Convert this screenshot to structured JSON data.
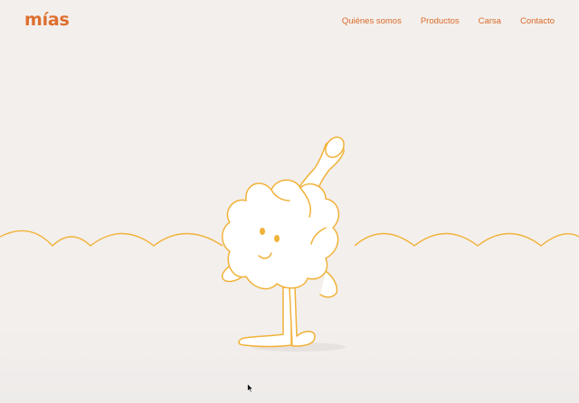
{
  "header": {
    "logo": "mías",
    "nav": [
      {
        "label": "Quiénes somos"
      },
      {
        "label": "Productos"
      },
      {
        "label": "Carsa"
      },
      {
        "label": "Contacto"
      }
    ]
  },
  "colors": {
    "background": "#f3efec",
    "accent": "#de6f2e",
    "illustration_stroke": "#f1b23a",
    "illustration_fill": "#ffffff"
  },
  "illustration": {
    "subject": "cauliflower-mascot-icon",
    "background_pattern": "scalloped-wave"
  }
}
